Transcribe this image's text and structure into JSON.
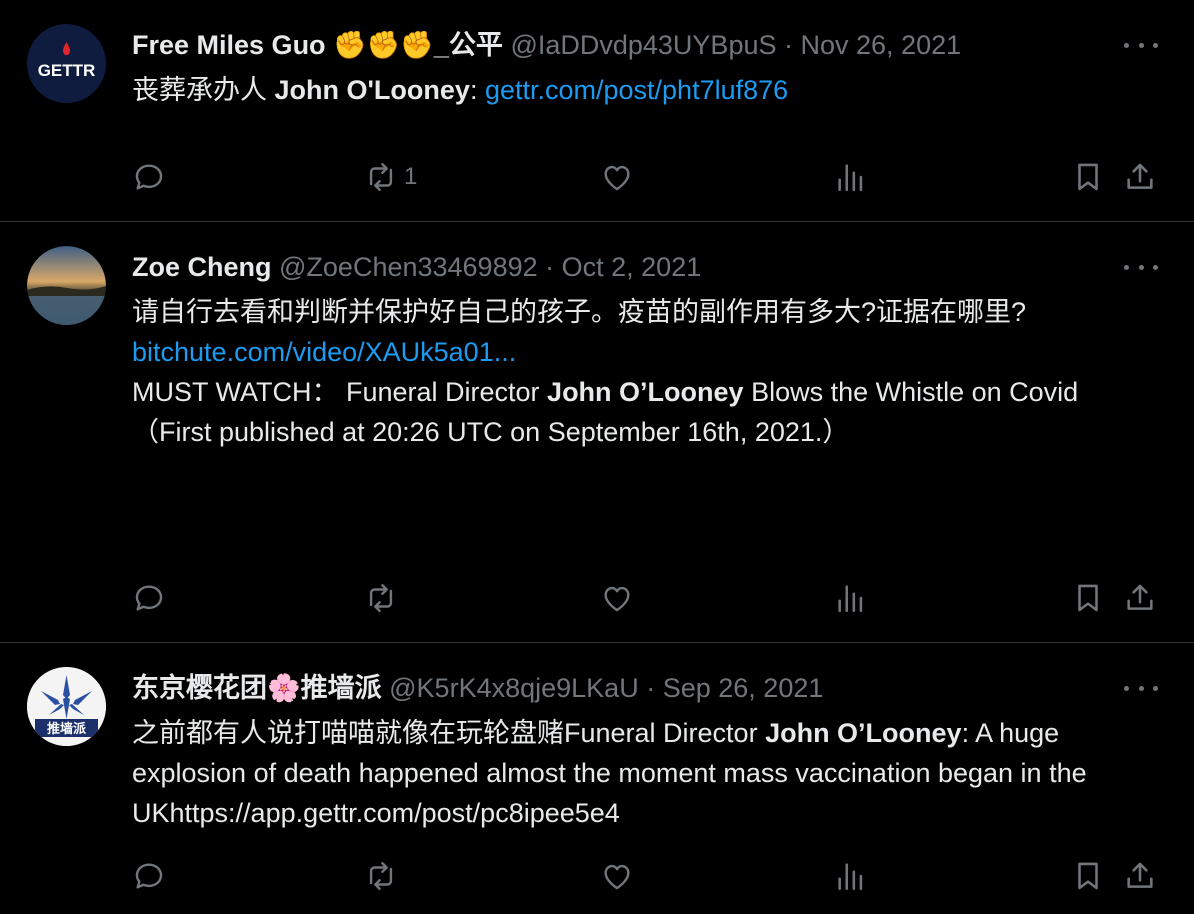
{
  "tweets": [
    {
      "avatar_text": "GETTR",
      "name": "Free Miles Guo ✊✊✊_公平",
      "handle": "@IaDDvdp43UYBpuS",
      "date": "Nov 26, 2021",
      "body": {
        "prefix": "丧葬承办人 ",
        "bold": "John O'Looney",
        "suffix": ":  ",
        "link": "gettr.com/post/pht7luf876"
      },
      "actions": {
        "reply": "",
        "retweet": "1",
        "like": ""
      }
    },
    {
      "name": "Zoe Cheng",
      "handle": "@ZoeChen33469892",
      "date": "Oct 2, 2021",
      "body": {
        "line1": "请自行去看和判断并保护好自己的孩子。疫苗的副作用有多大?证据在哪里?",
        "link": "bitchute.com/video/XAUk5a01...",
        "must_prefix": "MUST WATCH： Funeral Director ",
        "bold": "John O’Looney",
        "must_suffix": " Blows the Whistle on Covid",
        "published": "（First published at 20:26 UTC on  September 16th, 2021.）"
      },
      "actions": {
        "reply": "",
        "retweet": "",
        "like": ""
      }
    },
    {
      "avatar_text": "推墙派",
      "name": "东京樱花团🌸推墙派",
      "handle": "@K5rK4x8qje9LKaU",
      "date": "Sep 26, 2021",
      "body": {
        "prefix": "之前都有人说打喵喵就像在玩轮盘赌Funeral Director ",
        "bold": "John O’Looney",
        "suffix": ": A huge explosion of death happened almost the moment mass vaccination began in the UKhttps://app.gettr.com/post/pc8ipee5e4"
      },
      "actions": {
        "reply": "",
        "retweet": "",
        "like": ""
      }
    }
  ],
  "colors": {
    "background": "#000000",
    "text": "#e7e9ea",
    "muted": "#71767b",
    "link": "#1d9bf0",
    "divider": "#2f3336"
  }
}
